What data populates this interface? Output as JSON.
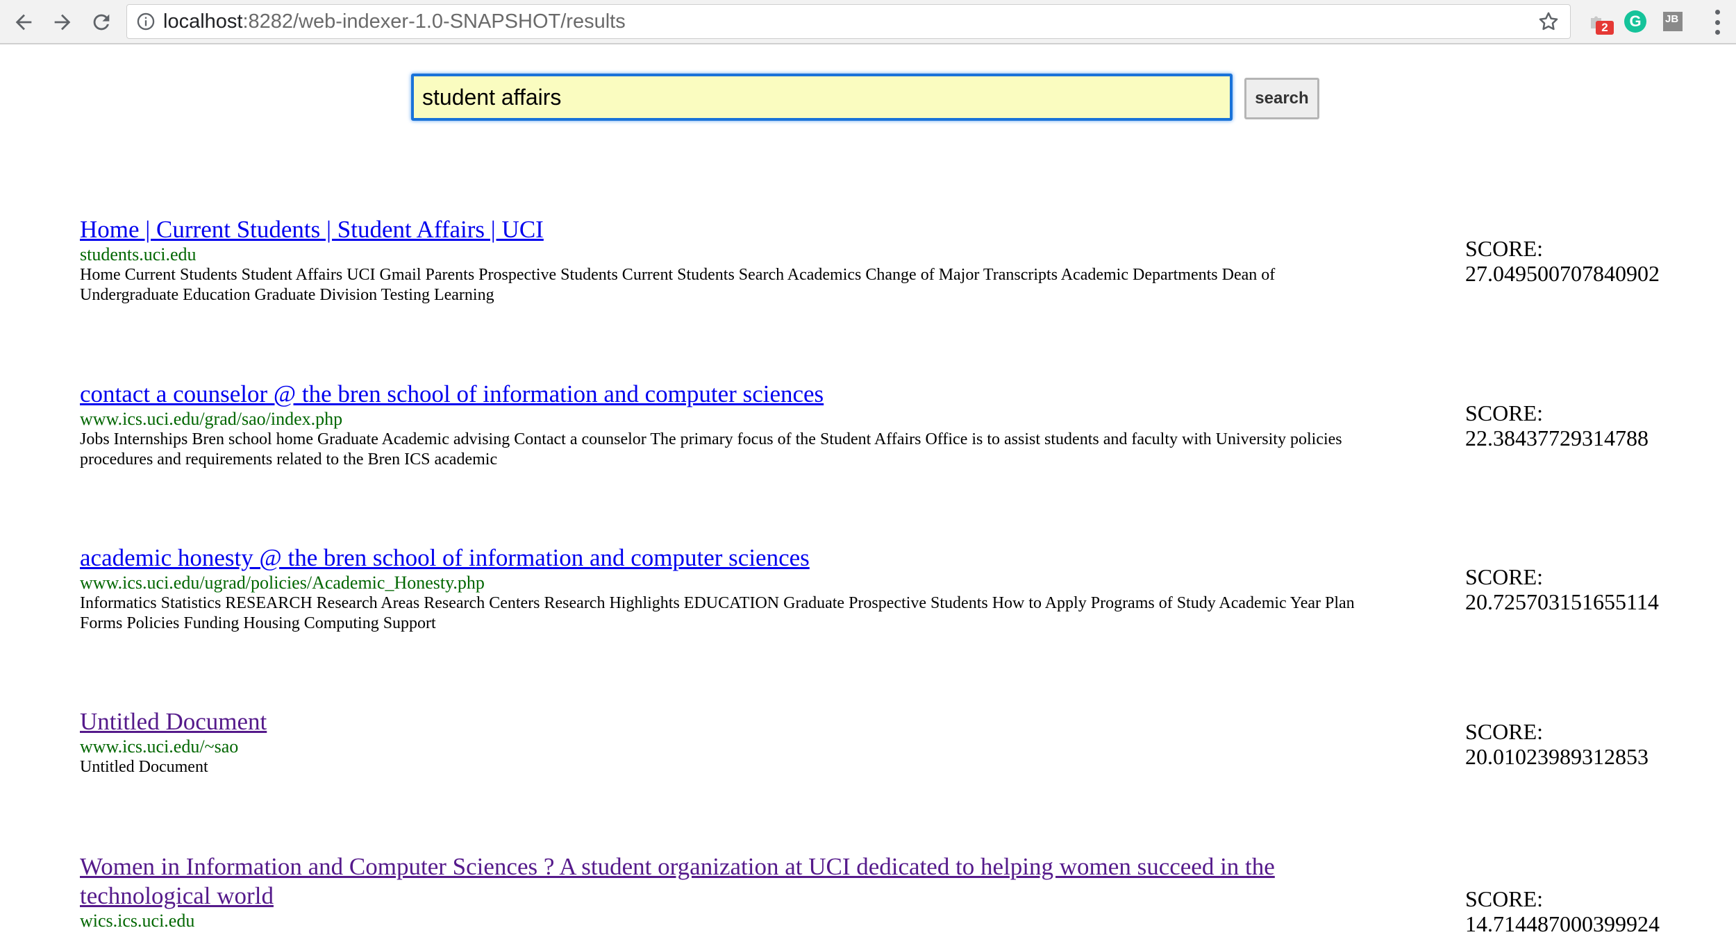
{
  "browser": {
    "url_host": "localhost",
    "url_path": ":8282/web-indexer-1.0-SNAPSHOT/results",
    "extension_badge": "2",
    "grammarly_letter": "G",
    "jb_label": "JB"
  },
  "search": {
    "query": "student affairs",
    "button_label": "search"
  },
  "score_label": "SCORE:",
  "results": [
    {
      "title": "Home | Current Students | Student Affairs | UCI",
      "url": "students.uci.edu",
      "snippet": "Home Current Students Student Affairs UCI Gmail Parents Prospective Students Current Students Search Academics Change of Major Transcripts Academic Departments Dean of Undergraduate Education Graduate Division Testing Learning",
      "score": "27.049500707840902",
      "visited": false
    },
    {
      "title": "contact a counselor @ the bren school of information and computer sciences",
      "url": "www.ics.uci.edu/grad/sao/index.php",
      "snippet": "Jobs Internships Bren school home Graduate Academic advising Contact a counselor The primary focus of the Student Affairs Office is to assist students and faculty with University policies procedures and requirements related to the Bren ICS academic",
      "score": "22.38437729314788",
      "visited": false
    },
    {
      "title": "academic honesty @ the bren school of information and computer sciences",
      "url": "www.ics.uci.edu/ugrad/policies/Academic_Honesty.php",
      "snippet": "Informatics Statistics RESEARCH Research Areas Research Centers Research Highlights EDUCATION Graduate Prospective Students How to Apply Programs of Study Academic Year Plan Forms Policies Funding Housing Computing Support",
      "score": "20.725703151655114",
      "visited": false
    },
    {
      "title": "Untitled Document",
      "url": "www.ics.uci.edu/~sao",
      "snippet": "Untitled Document",
      "score": "20.01023989312853",
      "visited": true
    },
    {
      "title": "Women in Information and Computer Sciences ? A student organization at UCI dedicated to helping women succeed in the technological world",
      "url": "wics.ics.uci.edu",
      "snippet": "",
      "score": "14.714487000399924",
      "visited": true
    }
  ]
}
